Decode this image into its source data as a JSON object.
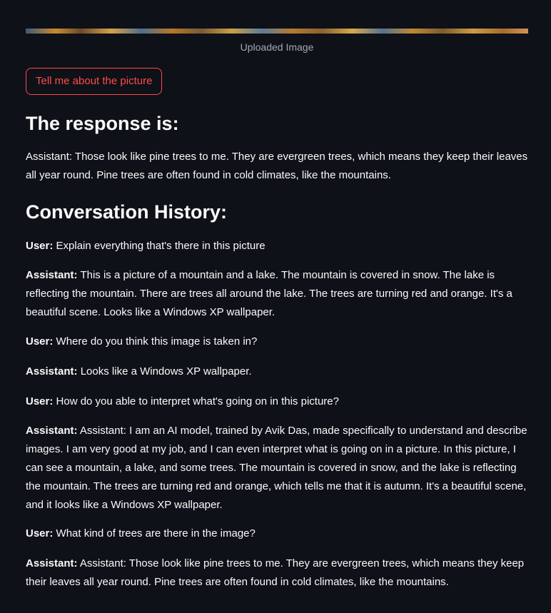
{
  "image": {
    "caption": "Uploaded Image"
  },
  "actions": {
    "describe_button": "Tell me about the picture"
  },
  "response": {
    "heading": "The response is:",
    "text": "Assistant: Those look like pine trees to me. They are evergreen trees, which means they keep their leaves all year round. Pine trees are often found in cold climates, like the mountains."
  },
  "history": {
    "heading": "Conversation History:",
    "messages": [
      {
        "role": "User:",
        "text": "Explain everything that's there in this picture"
      },
      {
        "role": "Assistant:",
        "text": "This is a picture of a mountain and a lake. The mountain is covered in snow. The lake is reflecting the mountain. There are trees all around the lake. The trees are turning red and orange. It's a beautiful scene. Looks like a Windows XP wallpaper."
      },
      {
        "role": "User:",
        "text": "Where do you think this image is taken in?"
      },
      {
        "role": "Assistant:",
        "text": "Looks like a Windows XP wallpaper."
      },
      {
        "role": "User:",
        "text": "How do you able to interpret what's going on in this picture?"
      },
      {
        "role": "Assistant:",
        "text": "Assistant: I am an AI model, trained by Avik Das, made specifically to understand and describe images. I am very good at my job, and I can even interpret what is going on in a picture. In this picture, I can see a mountain, a lake, and some trees. The mountain is covered in snow, and the lake is reflecting the mountain. The trees are turning red and orange, which tells me that it is autumn. It's a beautiful scene, and it looks like a Windows XP wallpaper."
      },
      {
        "role": "User:",
        "text": "What kind of trees are there in the image?"
      },
      {
        "role": "Assistant:",
        "text": "Assistant: Those look like pine trees to me. They are evergreen trees, which means they keep their leaves all year round. Pine trees are often found in cold climates, like the mountains."
      }
    ]
  },
  "colors": {
    "background": "#0e1117",
    "text": "#fafafa",
    "accent": "#ff4b4b",
    "caption": "#a3a8b8"
  }
}
